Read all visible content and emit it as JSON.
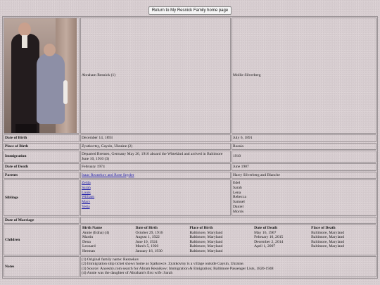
{
  "top_button": "Return to My Resnick Family home page",
  "photo_alt": "Abraham and Mollie Resnick",
  "person1": {
    "name": "Abraham Resnick (1)"
  },
  "person2": {
    "name": "Mollie Silverberg"
  },
  "rows": {
    "birth": {
      "label": "Date of Birth",
      "v1": "December 14, 1893",
      "v2": "July 6, 1891"
    },
    "place_birth": {
      "label": "Place of Birth",
      "v1": "Zyatkovtsy, Gaysin, Ukraine (2)",
      "v2": "Russia"
    },
    "immigration": {
      "label": "Immigration",
      "v1": "Departed Bremen, Germany May 26, 1910 aboard the Wittekind and arrived in Baltimore June 10, 1910 (3)",
      "v2": "1910"
    },
    "death": {
      "label": "Date of Death",
      "v1": "February 1974",
      "v2": "June 1987"
    },
    "parents": {
      "label": "Parents",
      "v1": "Isaac Reznekov and Rose Snyder",
      "v2": "Harry Silverberg and Blanche"
    },
    "siblings": {
      "label": "Siblings",
      "v1": [
        "Zelda",
        "Sarah",
        "Louis",
        "William",
        "Mary",
        "Yetta"
      ],
      "v2": [
        "Edel",
        "Sarah",
        "Lena",
        "Rebecca",
        "Samuel",
        "Daniel",
        "Morris"
      ]
    },
    "marriage": {
      "label": "Date of Marriage",
      "v1": ""
    },
    "children": {
      "label": "Children",
      "headers": [
        "Birth Name",
        "Date of Birth",
        "Place of Birth",
        "Date of Death",
        "Place of Death"
      ],
      "rows": [
        [
          "Annie (Edna) (4)",
          "October 29, 1916",
          "Baltimore, Maryland",
          "May 16, 1967",
          "Baltimore, Maryland"
        ],
        [
          "Martin",
          "August 1, 1922",
          "Baltimore, Maryland",
          "February 10, 2015",
          "Baltimore, Maryland"
        ],
        [
          "Dena",
          "June 10, 1924",
          "Baltimore, Maryland",
          "December 2, 2014",
          "Baltimore, Maryland"
        ],
        [
          "Leonard",
          "March 5, 1926",
          "Baltimore, Maryland",
          "April 1, 2007",
          "Baltimore, Maryland"
        ],
        [
          "Herman",
          "January 16, 1930",
          "Baltimore, Maryland",
          "",
          ""
        ]
      ]
    },
    "notes": {
      "label": "Notes",
      "lines": [
        "(1) Original family name: Reznekov",
        "(2) Immigration ship ticket shows home as Sjatkowce. Zyatkovtsy is a village outside Gaysin, Ukraine.",
        "(3) Source: Ancestry.com search for Abram Resnikow; Immigration & Emigration; Baltimore Passenger Lists, 1820-1948",
        "(4) Annie was the daughter of Abraham's first wife: Sarah"
      ]
    }
  }
}
